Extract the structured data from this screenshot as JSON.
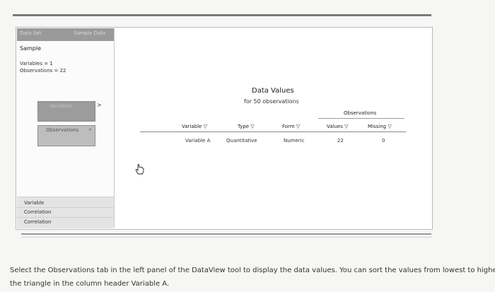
{
  "left_panel": {
    "data_set_label": "Data Set",
    "data_set_value": "Sample Data",
    "sample_name": "Sample",
    "variables_stat": "Variables = 1",
    "observations_stat": "Observations = 22",
    "variables_button": "Variables",
    "variables_arrow": ">",
    "observations_button": "Observations",
    "observations_arrow": ">",
    "analysis_items": [
      "Variable",
      "Correlation",
      "Correlation"
    ]
  },
  "table": {
    "title": "Data Values",
    "subtitle": "for 50 observations",
    "group_header": "Observations",
    "columns": [
      "Variable ▽",
      "Type ▽",
      "Form ▽",
      "Values ▽",
      "Missing ▽"
    ],
    "rows": [
      [
        "Variable A",
        "Quantitative",
        "Numeric",
        "22",
        "0"
      ]
    ]
  },
  "instructions": {
    "line1": "Select the Observations tab in the left panel of the DataView tool to display the data values. You can sort the values from lowest to highest b",
    "line2": "the triangle in the column header Variable A."
  },
  "icons": {
    "cursor": "hand-pointer-icon"
  }
}
